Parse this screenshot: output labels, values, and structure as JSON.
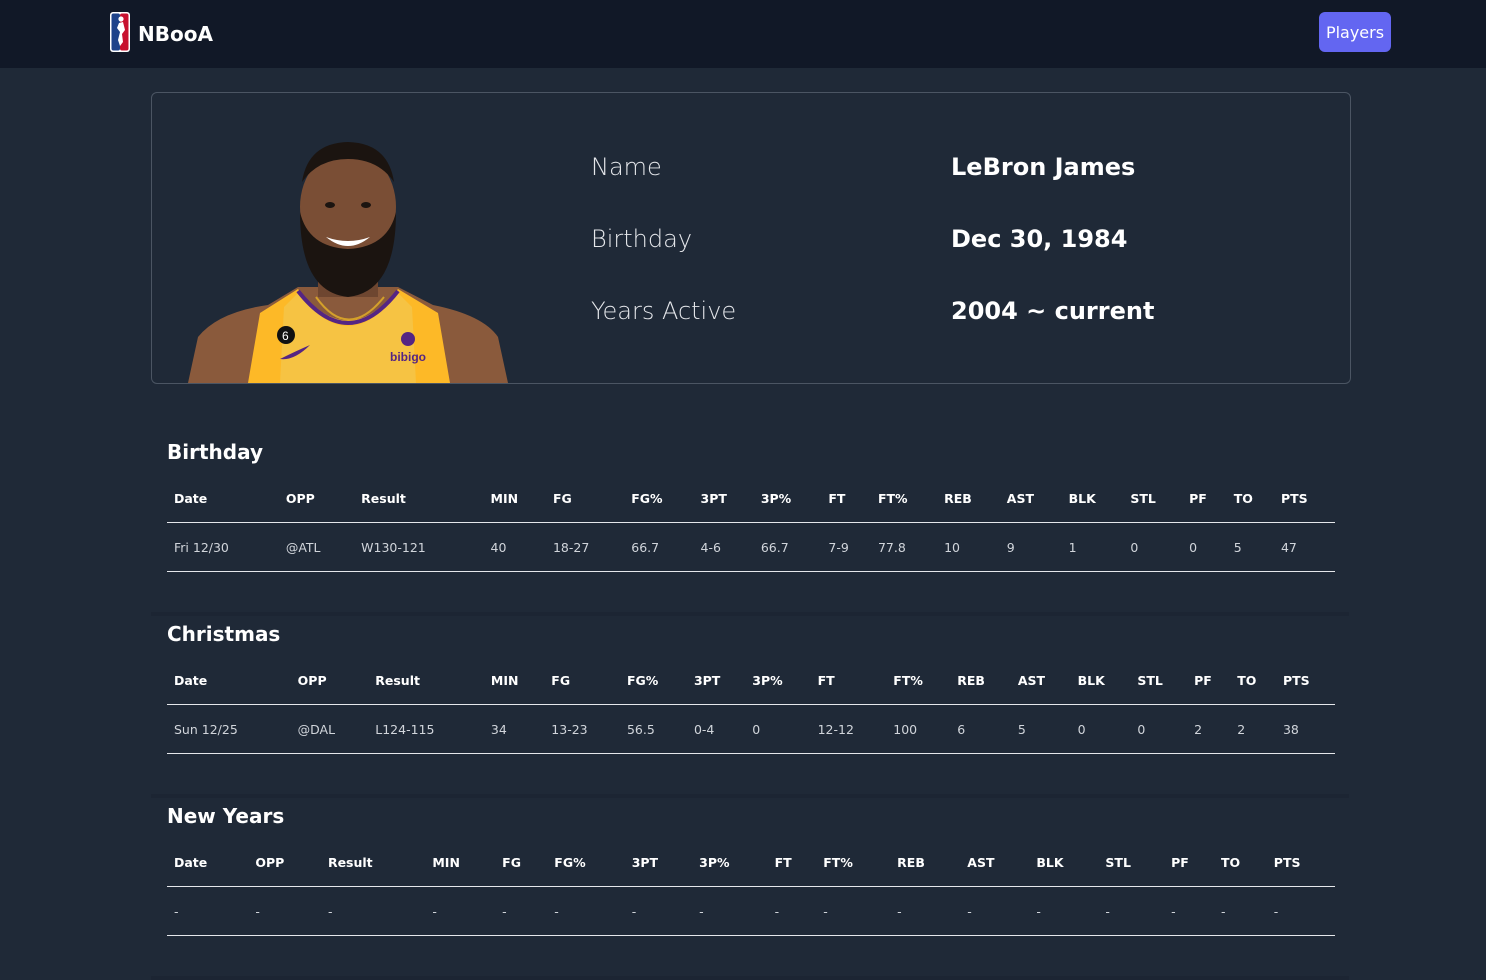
{
  "nav": {
    "brand": "NBooA",
    "logo_icon": "nba-logo-icon",
    "players_label": "Players",
    "accent": "#6366f1"
  },
  "profile": {
    "photo_icon": "player-headshot",
    "name_label": "Name",
    "name_value": "LeBron James",
    "birthday_label": "Birthday",
    "birthday_value": "Dec 30, 1984",
    "years_label": "Years Active",
    "years_value": "2004 ~ current"
  },
  "columns": [
    "Date",
    "OPP",
    "Result",
    "MIN",
    "FG",
    "FG%",
    "3PT",
    "3P%",
    "FT",
    "FT%",
    "REB",
    "AST",
    "BLK",
    "STL",
    "PF",
    "TO",
    "PTS"
  ],
  "sections": [
    {
      "title": "Birthday",
      "row": [
        "Fri 12/30",
        "@ATL",
        "W130-121",
        "40",
        "18-27",
        "66.7",
        "4-6",
        "66.7",
        "7-9",
        "77.8",
        "10",
        "9",
        "1",
        "0",
        "0",
        "5",
        "47"
      ]
    },
    {
      "title": "Christmas",
      "row": [
        "Sun 12/25",
        "@DAL",
        "L124-115",
        "34",
        "13-23",
        "56.5",
        "0-4",
        "0",
        "12-12",
        "100",
        "6",
        "5",
        "0",
        "0",
        "2",
        "2",
        "38"
      ]
    },
    {
      "title": "New Years",
      "row": [
        "-",
        "-",
        "-",
        "-",
        "-",
        "-",
        "-",
        "-",
        "-",
        "-",
        "-",
        "-",
        "-",
        "-",
        "-",
        "-",
        "-"
      ]
    }
  ]
}
